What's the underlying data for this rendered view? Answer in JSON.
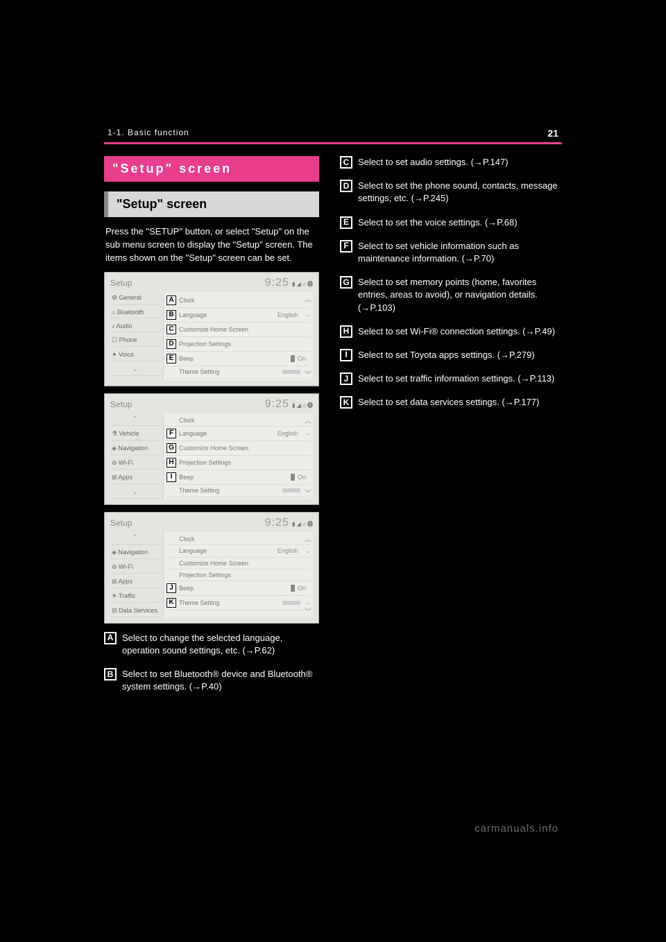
{
  "page": {
    "number": "21",
    "chapter": "1-1. Basic function",
    "watermark": "carmanuals.info"
  },
  "headings": {
    "pinkBar": "\"Setup\" screen",
    "grayBar": "\"Setup\" screen",
    "intro": "Press the \"SETUP\" button, or select \"Setup\" on the sub menu screen to display the \"Setup\" screen. The items shown on the \"Setup\" screen can be set."
  },
  "screenshots": {
    "common": {
      "title": "Setup",
      "time": "9:25",
      "statusIcons": "▮ ◢ ⌂ ⓿"
    },
    "s1": {
      "sidebar": [
        "⚙ General",
        "⌂ Bluetooth",
        "♪ Audio",
        "☐ Phone",
        "✦ Voice",
        "⌄"
      ],
      "rows": [
        {
          "letter": "A",
          "label": "Clock"
        },
        {
          "letter": "B",
          "label": "Language",
          "val": "English",
          "chev": "⌄"
        },
        {
          "letter": "C",
          "label": "Customize Home Screen"
        },
        {
          "letter": "D",
          "label": "Projection Settings"
        },
        {
          "letter": "E",
          "label": "Beep",
          "toggle": true,
          "val": "On"
        },
        {
          "letter": "",
          "label": "Theme Setting",
          "lines": true,
          "chev": "⌄"
        }
      ]
    },
    "s2": {
      "sidebar": [
        "⌃",
        "⚗ Vehicle",
        "◈ Navigation",
        "⊜ Wi-Fi",
        "⊞ Apps",
        "⌄"
      ],
      "rows": [
        {
          "letter": "",
          "label": "Clock"
        },
        {
          "letter": "F",
          "label": "Language",
          "val": "English",
          "chev": "⌄"
        },
        {
          "letter": "G",
          "label": "Customize Home Screen"
        },
        {
          "letter": "H",
          "label": "Projection Settings"
        },
        {
          "letter": "I",
          "label": "Beep",
          "toggle": true,
          "val": "On"
        },
        {
          "letter": "",
          "label": "Theme Setting",
          "lines": true,
          "chev": "⌄"
        }
      ]
    },
    "s3": {
      "sidebar": [
        "⌃",
        "◈ Navigation",
        "⊜ Wi-Fi",
        "⊞ Apps",
        "✈ Traffic",
        "⊟ Data Services"
      ],
      "rows": [
        {
          "letter": "",
          "label": "Clock"
        },
        {
          "letter": "",
          "label": "Language",
          "val": "English",
          "chev": "⌄"
        },
        {
          "letter": "",
          "label": "Customize Home Screen"
        },
        {
          "letter": "",
          "label": "Projection Settings"
        },
        {
          "letter": "J",
          "label": "Beep",
          "toggle": true,
          "val": "On"
        },
        {
          "letter": "K",
          "label": "Theme Setting",
          "lines": true,
          "chev": "⌄"
        }
      ]
    }
  },
  "calloutsLeft": [
    {
      "letter": "A",
      "text": "Select to change the selected language, operation sound settings, etc. (→P.62)"
    },
    {
      "letter": "B",
      "text": "Select to set Bluetooth® device and Bluetooth® system settings. (→P.40)"
    }
  ],
  "calloutsRight": [
    {
      "letter": "C",
      "text": "Select to set audio settings. (→P.147)"
    },
    {
      "letter": "D",
      "text": "Select to set the phone sound, contacts, message settings, etc. (→P.245)"
    },
    {
      "letter": "E",
      "text": "Select to set the voice settings. (→P.68)"
    },
    {
      "letter": "F",
      "text": "Select to set vehicle information such as maintenance information. (→P.70)"
    },
    {
      "letter": "G",
      "text": "Select to set memory points (home, favorites entries, areas to avoid), or navigation details. (→P.103)"
    },
    {
      "letter": "H",
      "text": "Select to set Wi-Fi® connection settings. (→P.49)"
    },
    {
      "letter": "I",
      "text": "Select to set Toyota apps settings. (→P.279)"
    },
    {
      "letter": "J",
      "text": "Select to set traffic information settings. (→P.113)"
    },
    {
      "letter": "K",
      "text": "Select to set data services settings. (→P.177)"
    }
  ]
}
